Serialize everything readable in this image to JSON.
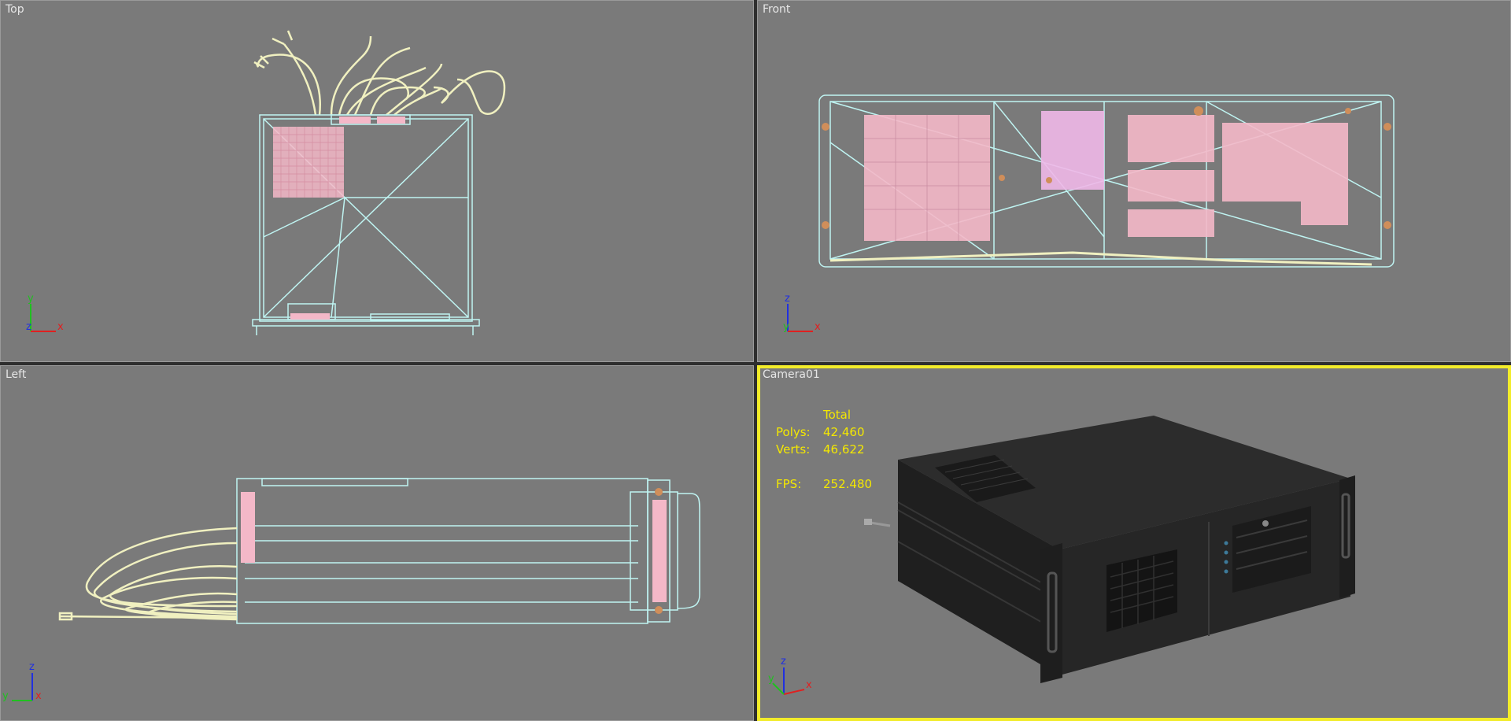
{
  "viewports": {
    "top": {
      "label": "Top",
      "axis": {
        "vertical": "y",
        "depth": "z",
        "horizontal": "x"
      }
    },
    "front": {
      "label": "Front",
      "axis": {
        "vertical": "z",
        "depth": "y",
        "horizontal": "x"
      }
    },
    "left": {
      "label": "Left",
      "axis": {
        "vertical": "z",
        "depth": "x",
        "horizontal": "y"
      }
    },
    "camera": {
      "label": "Camera01",
      "axis": {
        "vertical": "z",
        "depth": "y",
        "horizontal": "x"
      },
      "stats": {
        "header": "Total",
        "polys_label": "Polys:",
        "polys_value": "42,460",
        "verts_label": "Verts:",
        "verts_value": "46,622",
        "fps_label": "FPS:",
        "fps_value": "252.480"
      }
    }
  },
  "colors": {
    "viewport_bg": "#7a7a7a",
    "active_border": "#f2ec2a",
    "wire_cyan": "#bff4f2",
    "wire_cable": "#f0f0c0",
    "wire_pink": "#f4b8c8",
    "stats_text": "#f4e800",
    "axis_x": "#e02020",
    "axis_y": "#20c020",
    "axis_z": "#2030e0"
  }
}
